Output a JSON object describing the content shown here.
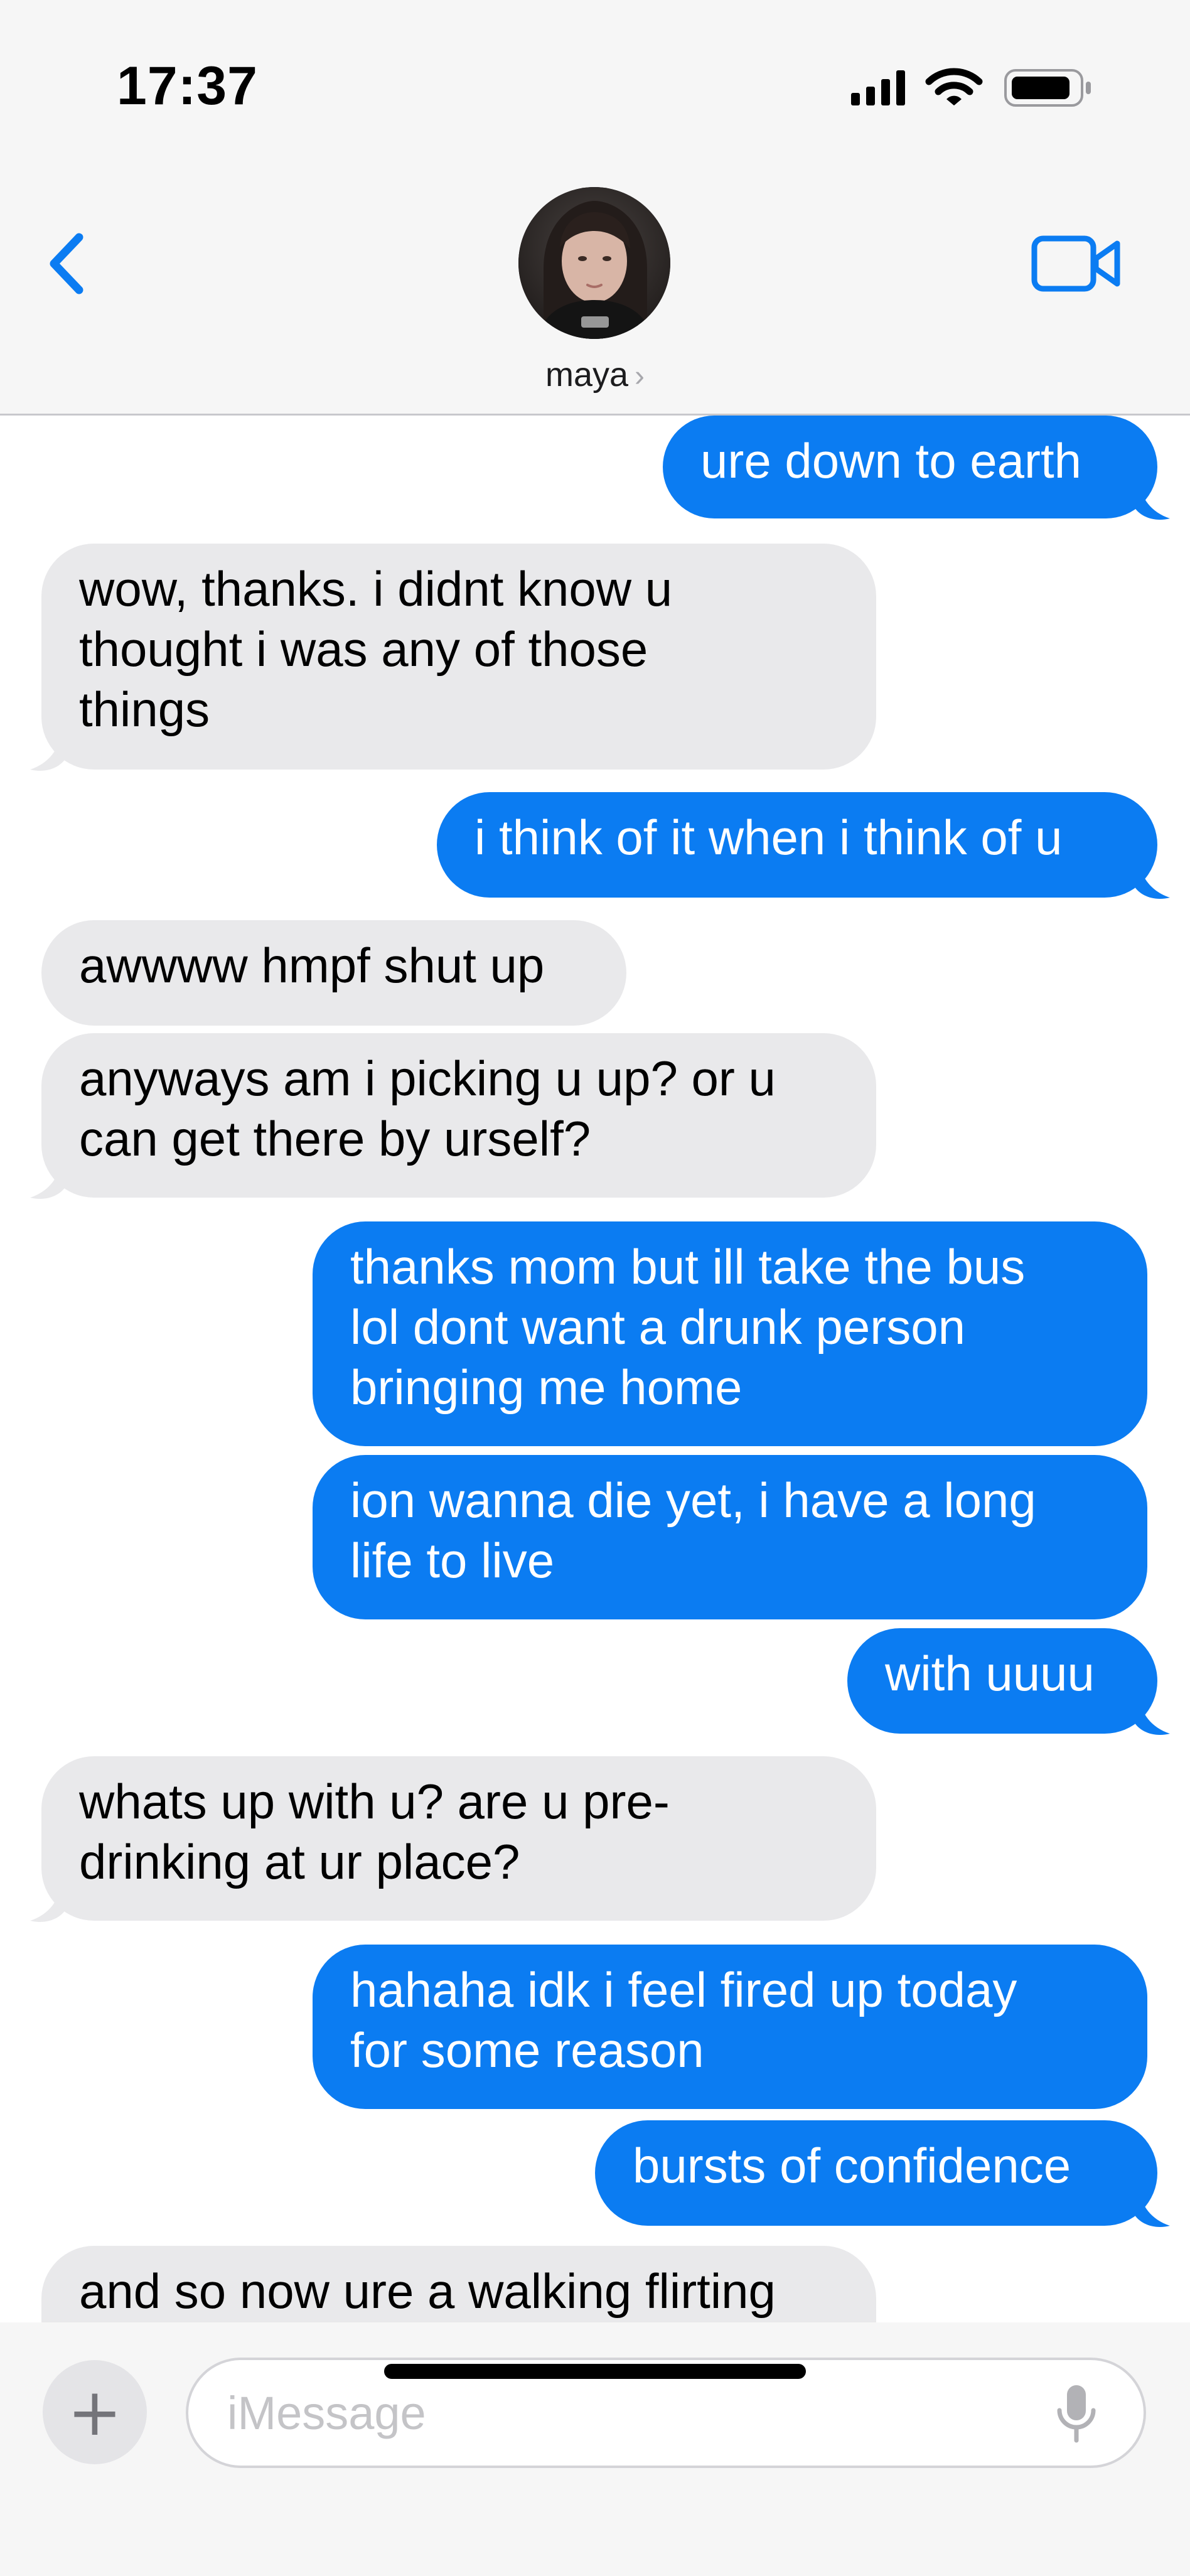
{
  "status_bar": {
    "time": "17:37"
  },
  "header": {
    "contact_name": "maya",
    "chevron": "›",
    "back_icon": "chevron-left-icon",
    "video_icon": "video-camera-icon"
  },
  "colors": {
    "accent": "#0b7cf2",
    "received_bubble": "#e9e9eb",
    "header_bg": "#f6f6f6"
  },
  "messages": [
    {
      "direction": "sent",
      "text": "ure down to earth"
    },
    {
      "direction": "received",
      "text": "wow, thanks. i didnt know u\nthought i was any of those\nthings"
    },
    {
      "direction": "sent",
      "text": "i think of it when i think of u"
    },
    {
      "direction": "received",
      "text": "awwww hmpf shut up"
    },
    {
      "direction": "received",
      "text": "anyways am i picking u up? or u\ncan get there by urself?"
    },
    {
      "direction": "sent",
      "text": "thanks mom but ill take the bus\nlol dont want a drunk person\nbringing me home"
    },
    {
      "direction": "sent",
      "text": "ion wanna die yet, i have a long\nlife to live"
    },
    {
      "direction": "sent",
      "text": "with uuuu"
    },
    {
      "direction": "received",
      "text": "whats up with u? are u pre-\ndrinking at ur place?"
    },
    {
      "direction": "sent",
      "text": "hahaha idk i feel fired up today\nfor some reason"
    },
    {
      "direction": "sent",
      "text": "bursts of confidence"
    },
    {
      "direction": "received",
      "text": "and so now ure a walking flirting"
    }
  ],
  "composer": {
    "placeholder": "iMessage",
    "value": "",
    "plus_label": "+",
    "mic_icon": "microphone-icon"
  }
}
